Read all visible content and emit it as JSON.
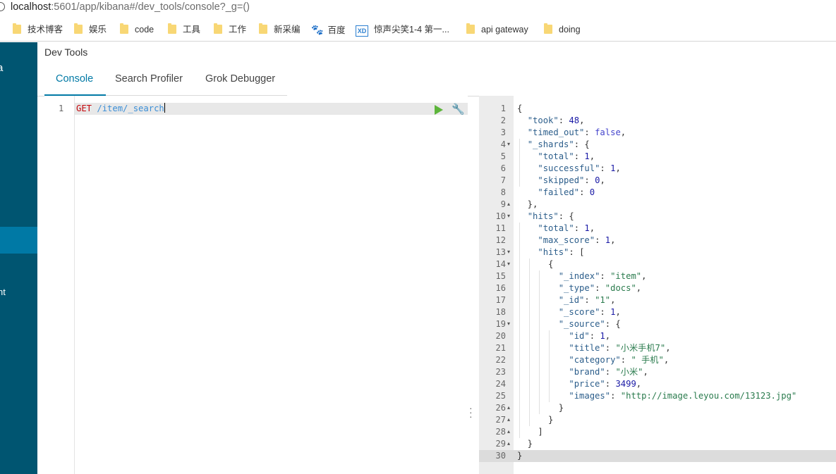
{
  "browser": {
    "url_host": "localhost",
    "url_rest": ":5601/app/kibana#/dev_tools/console?_g=()"
  },
  "bookmarks": [
    {
      "label": "技术博客",
      "icon": "folder-icon"
    },
    {
      "label": "娱乐",
      "icon": "folder-icon"
    },
    {
      "label": "code",
      "icon": "folder-icon"
    },
    {
      "label": "工具",
      "icon": "folder-icon"
    },
    {
      "label": "工作",
      "icon": "folder-icon"
    },
    {
      "label": "新采编",
      "icon": "folder-icon"
    },
    {
      "label": "百度",
      "icon": "baidu-paw-icon"
    },
    {
      "label": "惊声尖笑1-4 第一...",
      "icon": "xd-site-icon"
    },
    {
      "label": "api gateway",
      "icon": "folder-icon"
    },
    {
      "label": "doing",
      "icon": "folder-icon"
    }
  ],
  "sidebar": {
    "fragments": [
      "a",
      "nt"
    ]
  },
  "header": {
    "title": "Dev Tools",
    "tabs": [
      "Console",
      "Search Profiler",
      "Grok Debugger"
    ],
    "active_tab": "Console"
  },
  "editor": {
    "line_number": "1",
    "method": "GET",
    "path": "/item/_search"
  },
  "output": {
    "line_numbers": [
      "1",
      "2",
      "3",
      "4",
      "5",
      "6",
      "7",
      "8",
      "9",
      "10",
      "11",
      "12",
      "13",
      "14",
      "15",
      "16",
      "17",
      "18",
      "19",
      "20",
      "21",
      "22",
      "23",
      "24",
      "25",
      "26",
      "27",
      "28",
      "29",
      "30"
    ],
    "lines": [
      [
        [
          "p",
          "{"
        ]
      ],
      [
        [
          "p",
          "  "
        ],
        [
          "k",
          "\"took\""
        ],
        [
          "p",
          ": "
        ],
        [
          "n",
          "48"
        ],
        [
          "p",
          ","
        ]
      ],
      [
        [
          "p",
          "  "
        ],
        [
          "k",
          "\"timed_out\""
        ],
        [
          "p",
          ": "
        ],
        [
          "b",
          "false"
        ],
        [
          "p",
          ","
        ]
      ],
      [
        [
          "p",
          "  "
        ],
        [
          "k",
          "\"_shards\""
        ],
        [
          "p",
          ": {"
        ]
      ],
      [
        [
          "p",
          "    "
        ],
        [
          "k",
          "\"total\""
        ],
        [
          "p",
          ": "
        ],
        [
          "n",
          "1"
        ],
        [
          "p",
          ","
        ]
      ],
      [
        [
          "p",
          "    "
        ],
        [
          "k",
          "\"successful\""
        ],
        [
          "p",
          ": "
        ],
        [
          "n",
          "1"
        ],
        [
          "p",
          ","
        ]
      ],
      [
        [
          "p",
          "    "
        ],
        [
          "k",
          "\"skipped\""
        ],
        [
          "p",
          ": "
        ],
        [
          "n",
          "0"
        ],
        [
          "p",
          ","
        ]
      ],
      [
        [
          "p",
          "    "
        ],
        [
          "k",
          "\"failed\""
        ],
        [
          "p",
          ": "
        ],
        [
          "n",
          "0"
        ]
      ],
      [
        [
          "p",
          "  },"
        ]
      ],
      [
        [
          "p",
          "  "
        ],
        [
          "k",
          "\"hits\""
        ],
        [
          "p",
          ": {"
        ]
      ],
      [
        [
          "p",
          "    "
        ],
        [
          "k",
          "\"total\""
        ],
        [
          "p",
          ": "
        ],
        [
          "n",
          "1"
        ],
        [
          "p",
          ","
        ]
      ],
      [
        [
          "p",
          "    "
        ],
        [
          "k",
          "\"max_score\""
        ],
        [
          "p",
          ": "
        ],
        [
          "n",
          "1"
        ],
        [
          "p",
          ","
        ]
      ],
      [
        [
          "p",
          "    "
        ],
        [
          "k",
          "\"hits\""
        ],
        [
          "p",
          ": ["
        ]
      ],
      [
        [
          "p",
          "      {"
        ]
      ],
      [
        [
          "p",
          "        "
        ],
        [
          "k",
          "\"_index\""
        ],
        [
          "p",
          ": "
        ],
        [
          "s",
          "\"item\""
        ],
        [
          "p",
          ","
        ]
      ],
      [
        [
          "p",
          "        "
        ],
        [
          "k",
          "\"_type\""
        ],
        [
          "p",
          ": "
        ],
        [
          "s",
          "\"docs\""
        ],
        [
          "p",
          ","
        ]
      ],
      [
        [
          "p",
          "        "
        ],
        [
          "k",
          "\"_id\""
        ],
        [
          "p",
          ": "
        ],
        [
          "s",
          "\"1\""
        ],
        [
          "p",
          ","
        ]
      ],
      [
        [
          "p",
          "        "
        ],
        [
          "k",
          "\"_score\""
        ],
        [
          "p",
          ": "
        ],
        [
          "n",
          "1"
        ],
        [
          "p",
          ","
        ]
      ],
      [
        [
          "p",
          "        "
        ],
        [
          "k",
          "\"_source\""
        ],
        [
          "p",
          ": {"
        ]
      ],
      [
        [
          "p",
          "          "
        ],
        [
          "k",
          "\"id\""
        ],
        [
          "p",
          ": "
        ],
        [
          "n",
          "1"
        ],
        [
          "p",
          ","
        ]
      ],
      [
        [
          "p",
          "          "
        ],
        [
          "k",
          "\"title\""
        ],
        [
          "p",
          ": "
        ],
        [
          "s",
          "\"小米手机7\""
        ],
        [
          "p",
          ","
        ]
      ],
      [
        [
          "p",
          "          "
        ],
        [
          "k",
          "\"category\""
        ],
        [
          "p",
          ": "
        ],
        [
          "s",
          "\" 手机\""
        ],
        [
          "p",
          ","
        ]
      ],
      [
        [
          "p",
          "          "
        ],
        [
          "k",
          "\"brand\""
        ],
        [
          "p",
          ": "
        ],
        [
          "s",
          "\"小米\""
        ],
        [
          "p",
          ","
        ]
      ],
      [
        [
          "p",
          "          "
        ],
        [
          "k",
          "\"price\""
        ],
        [
          "p",
          ": "
        ],
        [
          "n",
          "3499"
        ],
        [
          "p",
          ","
        ]
      ],
      [
        [
          "p",
          "          "
        ],
        [
          "k",
          "\"images\""
        ],
        [
          "p",
          ": "
        ],
        [
          "s",
          "\"http://image.leyou.com/13123.jpg\""
        ]
      ],
      [
        [
          "p",
          "        }"
        ]
      ],
      [
        [
          "p",
          "      }"
        ]
      ],
      [
        [
          "p",
          "    ]"
        ]
      ],
      [
        [
          "p",
          "  }"
        ]
      ],
      [
        [
          "p",
          "}"
        ]
      ]
    ],
    "fold_down": [
      "4",
      "10",
      "13",
      "14",
      "19"
    ],
    "fold_up": [
      "9",
      "26",
      "27",
      "28",
      "29"
    ]
  }
}
